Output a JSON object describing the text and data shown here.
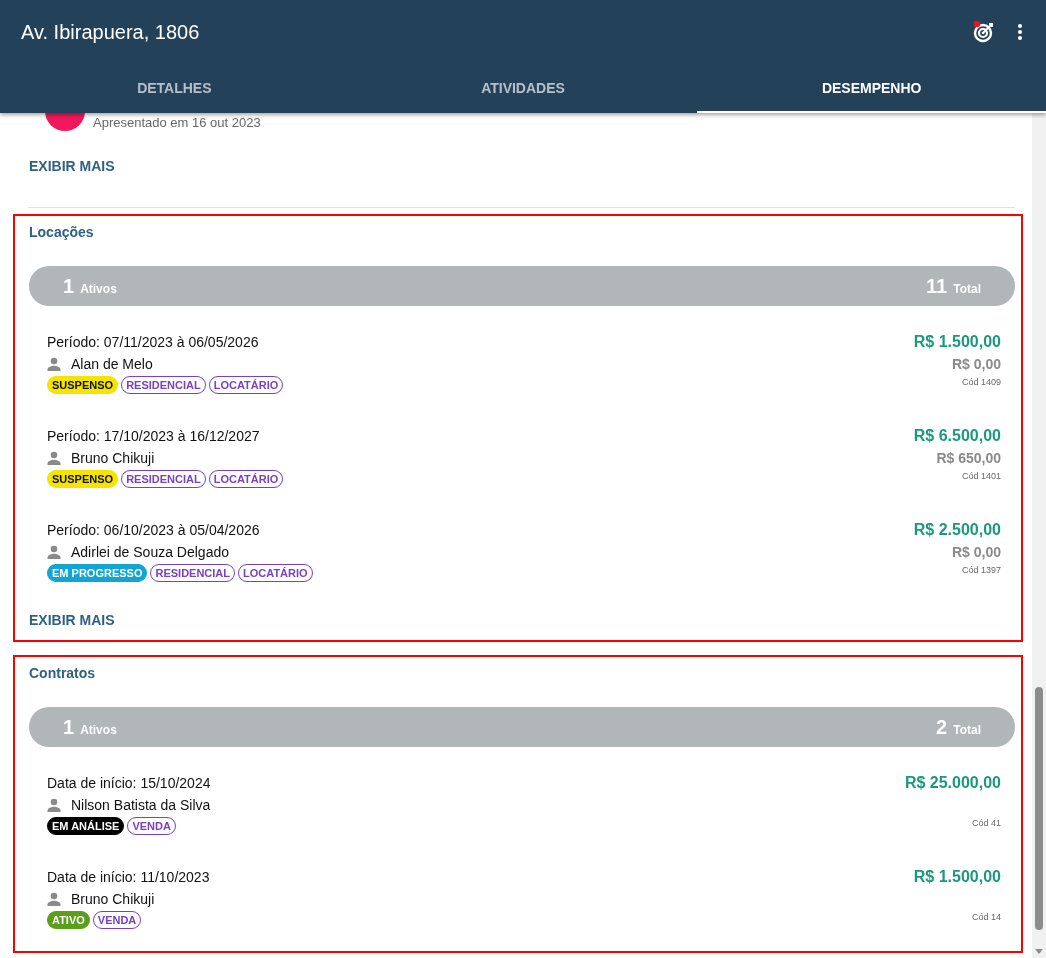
{
  "header": {
    "title": "Av. Ibirapuera, 1806"
  },
  "tabs": [
    {
      "label": "DETALHES",
      "selected": false
    },
    {
      "label": "ATIVIDADES",
      "selected": false
    },
    {
      "label": "DESEMPENHO",
      "selected": true
    }
  ],
  "presenter": {
    "caption": "Apresentado em 16 out 2023",
    "show_more": "EXIBIR MAIS"
  },
  "sections": [
    {
      "title": "Locações",
      "highlighted": true,
      "active_count": "1",
      "active_label": "Ativos",
      "total_count": "11",
      "total_label": "Total",
      "show_more": "EXIBIR MAIS",
      "items": [
        {
          "period": "Período: 07/11/2023 à 06/05/2026",
          "person": "Alan de Melo",
          "amount": "R$ 1.500,00",
          "secondary_amount": "R$ 0,00",
          "code": "Cód 1409",
          "tags": [
            {
              "label": "SUSPENSO",
              "kind": "status",
              "color": "#f5e400"
            },
            {
              "label": "RESIDENCIAL",
              "kind": "category",
              "color": "#7b3fc4"
            },
            {
              "label": "LOCATÁRIO",
              "kind": "category",
              "color": "#7b3fc4"
            }
          ]
        },
        {
          "period": "Período: 17/10/2023 à 16/12/2027",
          "person": "Bruno Chikuji",
          "amount": "R$ 6.500,00",
          "secondary_amount": "R$ 650,00",
          "code": "Cód 1401",
          "tags": [
            {
              "label": "SUSPENSO",
              "kind": "status",
              "color": "#f5e400"
            },
            {
              "label": "RESIDENCIAL",
              "kind": "category",
              "color": "#7b3fc4"
            },
            {
              "label": "LOCATÁRIO",
              "kind": "category",
              "color": "#7b3fc4"
            }
          ]
        },
        {
          "period": "Período: 06/10/2023 à 05/04/2026",
          "person": "Adirlei de Souza Delgado",
          "amount": "R$ 2.500,00",
          "secondary_amount": "R$ 0,00",
          "code": "Cód 1397",
          "tags": [
            {
              "label": "EM PROGRESSO",
              "kind": "status",
              "color": "#12a5d3"
            },
            {
              "label": "RESIDENCIAL",
              "kind": "category",
              "color": "#7b3fc4"
            },
            {
              "label": "LOCATÁRIO",
              "kind": "category",
              "color": "#7b3fc4"
            }
          ]
        }
      ]
    },
    {
      "title": "Contratos",
      "highlighted": true,
      "active_count": "1",
      "active_label": "Ativos",
      "total_count": "2",
      "total_label": "Total",
      "items": [
        {
          "period": "Data de início: 15/10/2024",
          "person": "Nilson Batista da Silva",
          "amount": "R$ 25.000,00",
          "code": "Cód 41",
          "tags": [
            {
              "label": "EM ANÁLISE",
              "kind": "status",
              "color": "#000000"
            },
            {
              "label": "VENDA",
              "kind": "category",
              "color": "#7b3fc4"
            }
          ]
        },
        {
          "period": "Data de início: 11/10/2023",
          "person": "Bruno Chikuji",
          "amount": "R$ 1.500,00",
          "code": "Cód 14",
          "tags": [
            {
              "label": "ATIVO",
              "kind": "status",
              "color": "#5a9e1b"
            },
            {
              "label": "VENDA",
              "kind": "category",
              "color": "#7b3fc4"
            }
          ]
        }
      ]
    }
  ]
}
